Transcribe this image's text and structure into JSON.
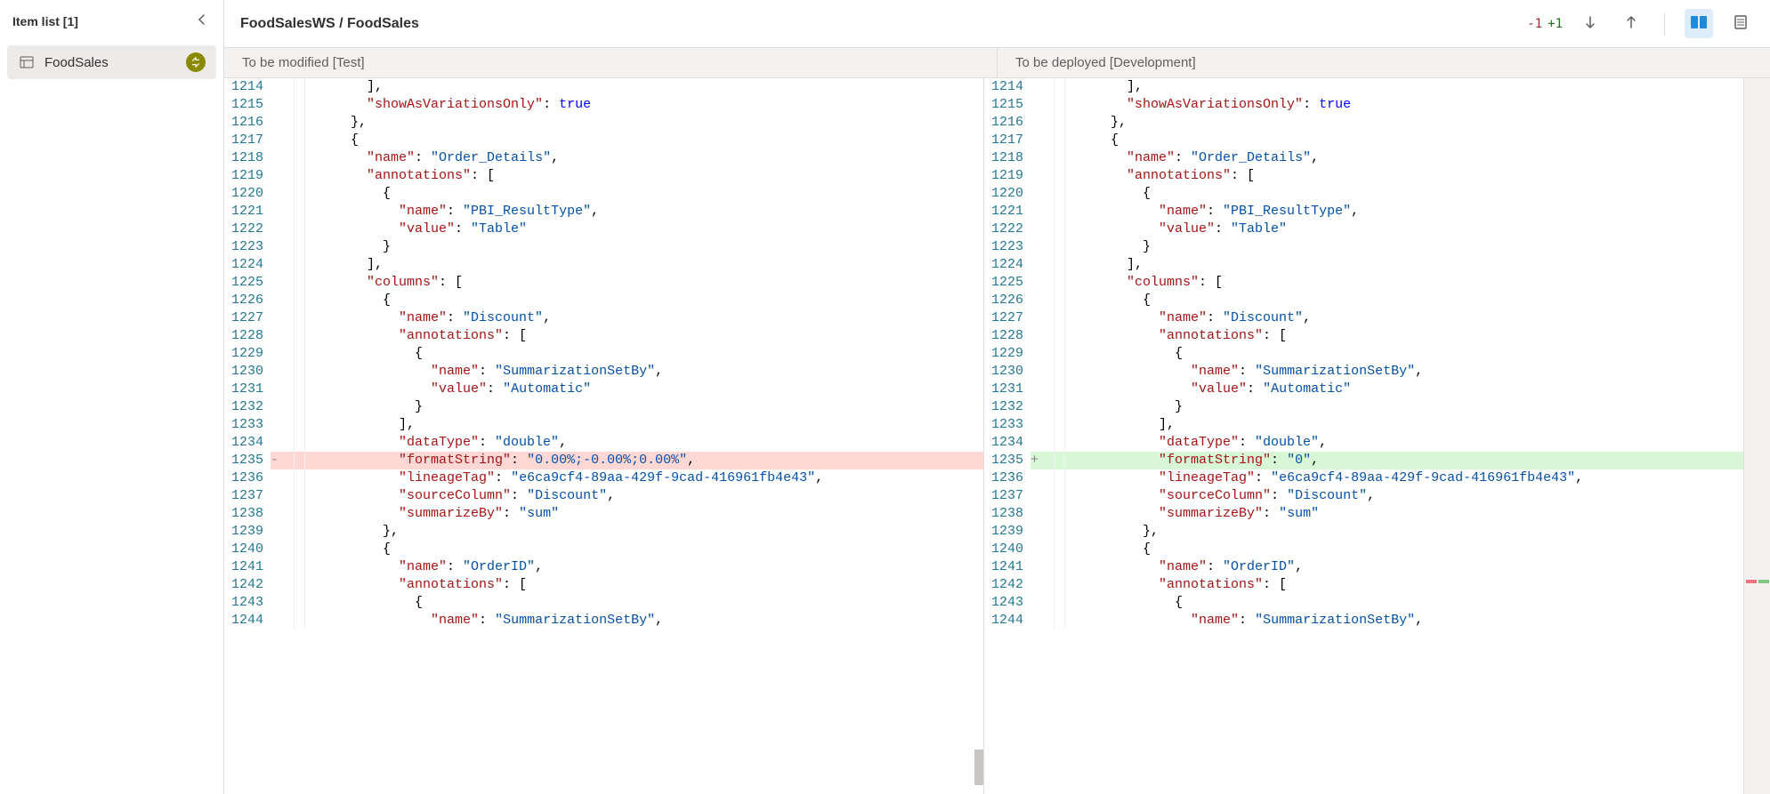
{
  "sidebar": {
    "title": "Item list [1]",
    "items": [
      {
        "label": "FoodSales"
      }
    ]
  },
  "header": {
    "breadcrumb": "FoodSalesWS / FoodSales",
    "deletions": "-1",
    "additions": "+1"
  },
  "panes": {
    "left_title": "To be modified [Test]",
    "right_title": "To be deployed [Development]"
  },
  "code_left": [
    {
      "n": 1214,
      "indent": 3,
      "tokens": [
        [
          "punc",
          "],"
        ]
      ]
    },
    {
      "n": 1215,
      "indent": 3,
      "tokens": [
        [
          "key",
          "\"showAsVariationsOnly\""
        ],
        [
          "punc",
          ": "
        ],
        [
          "bool",
          "true"
        ]
      ]
    },
    {
      "n": 1216,
      "indent": 2,
      "tokens": [
        [
          "punc",
          "},"
        ]
      ]
    },
    {
      "n": 1217,
      "indent": 2,
      "tokens": [
        [
          "punc",
          "{"
        ]
      ]
    },
    {
      "n": 1218,
      "indent": 3,
      "tokens": [
        [
          "key",
          "\"name\""
        ],
        [
          "punc",
          ": "
        ],
        [
          "str",
          "\"Order_Details\""
        ],
        [
          "punc",
          ","
        ]
      ]
    },
    {
      "n": 1219,
      "indent": 3,
      "tokens": [
        [
          "key",
          "\"annotations\""
        ],
        [
          "punc",
          ": ["
        ]
      ]
    },
    {
      "n": 1220,
      "indent": 4,
      "tokens": [
        [
          "punc",
          "{"
        ]
      ]
    },
    {
      "n": 1221,
      "indent": 5,
      "tokens": [
        [
          "key",
          "\"name\""
        ],
        [
          "punc",
          ": "
        ],
        [
          "str",
          "\"PBI_ResultType\""
        ],
        [
          "punc",
          ","
        ]
      ]
    },
    {
      "n": 1222,
      "indent": 5,
      "tokens": [
        [
          "key",
          "\"value\""
        ],
        [
          "punc",
          ": "
        ],
        [
          "str",
          "\"Table\""
        ]
      ]
    },
    {
      "n": 1223,
      "indent": 4,
      "tokens": [
        [
          "punc",
          "}"
        ]
      ]
    },
    {
      "n": 1224,
      "indent": 3,
      "tokens": [
        [
          "punc",
          "],"
        ]
      ]
    },
    {
      "n": 1225,
      "indent": 3,
      "tokens": [
        [
          "key",
          "\"columns\""
        ],
        [
          "punc",
          ": ["
        ]
      ]
    },
    {
      "n": 1226,
      "indent": 4,
      "tokens": [
        [
          "punc",
          "{"
        ]
      ]
    },
    {
      "n": 1227,
      "indent": 5,
      "tokens": [
        [
          "key",
          "\"name\""
        ],
        [
          "punc",
          ": "
        ],
        [
          "str",
          "\"Discount\""
        ],
        [
          "punc",
          ","
        ]
      ]
    },
    {
      "n": 1228,
      "indent": 5,
      "tokens": [
        [
          "key",
          "\"annotations\""
        ],
        [
          "punc",
          ": ["
        ]
      ]
    },
    {
      "n": 1229,
      "indent": 6,
      "tokens": [
        [
          "punc",
          "{"
        ]
      ]
    },
    {
      "n": 1230,
      "indent": 7,
      "tokens": [
        [
          "key",
          "\"name\""
        ],
        [
          "punc",
          ": "
        ],
        [
          "str",
          "\"SummarizationSetBy\""
        ],
        [
          "punc",
          ","
        ]
      ]
    },
    {
      "n": 1231,
      "indent": 7,
      "tokens": [
        [
          "key",
          "\"value\""
        ],
        [
          "punc",
          ": "
        ],
        [
          "str",
          "\"Automatic\""
        ]
      ]
    },
    {
      "n": 1232,
      "indent": 6,
      "tokens": [
        [
          "punc",
          "}"
        ]
      ]
    },
    {
      "n": 1233,
      "indent": 5,
      "tokens": [
        [
          "punc",
          "],"
        ]
      ]
    },
    {
      "n": 1234,
      "indent": 5,
      "tokens": [
        [
          "key",
          "\"dataType\""
        ],
        [
          "punc",
          ": "
        ],
        [
          "str",
          "\"double\""
        ],
        [
          "punc",
          ","
        ]
      ]
    },
    {
      "n": 1235,
      "indent": 5,
      "diff": "removed",
      "tokens": [
        [
          "key",
          "\"formatString\""
        ],
        [
          "punc",
          ": "
        ],
        [
          "str",
          "\"0.00%;-0.00%;0.00%\""
        ],
        [
          "punc",
          ","
        ]
      ]
    },
    {
      "n": 1236,
      "indent": 5,
      "tokens": [
        [
          "key",
          "\"lineageTag\""
        ],
        [
          "punc",
          ": "
        ],
        [
          "str",
          "\"e6ca9cf4-89aa-429f-9cad-416961fb4e43\""
        ],
        [
          "punc",
          ","
        ]
      ]
    },
    {
      "n": 1237,
      "indent": 5,
      "tokens": [
        [
          "key",
          "\"sourceColumn\""
        ],
        [
          "punc",
          ": "
        ],
        [
          "str",
          "\"Discount\""
        ],
        [
          "punc",
          ","
        ]
      ]
    },
    {
      "n": 1238,
      "indent": 5,
      "tokens": [
        [
          "key",
          "\"summarizeBy\""
        ],
        [
          "punc",
          ": "
        ],
        [
          "str",
          "\"sum\""
        ]
      ]
    },
    {
      "n": 1239,
      "indent": 4,
      "tokens": [
        [
          "punc",
          "},"
        ]
      ]
    },
    {
      "n": 1240,
      "indent": 4,
      "tokens": [
        [
          "punc",
          "{"
        ]
      ]
    },
    {
      "n": 1241,
      "indent": 5,
      "tokens": [
        [
          "key",
          "\"name\""
        ],
        [
          "punc",
          ": "
        ],
        [
          "str",
          "\"OrderID\""
        ],
        [
          "punc",
          ","
        ]
      ]
    },
    {
      "n": 1242,
      "indent": 5,
      "tokens": [
        [
          "key",
          "\"annotations\""
        ],
        [
          "punc",
          ": ["
        ]
      ]
    },
    {
      "n": 1243,
      "indent": 6,
      "tokens": [
        [
          "punc",
          "{"
        ]
      ]
    },
    {
      "n": 1244,
      "indent": 7,
      "tokens": [
        [
          "key",
          "\"name\""
        ],
        [
          "punc",
          ": "
        ],
        [
          "str",
          "\"SummarizationSetBy\""
        ],
        [
          "punc",
          ","
        ]
      ]
    }
  ],
  "code_right": [
    {
      "n": 1214,
      "indent": 3,
      "tokens": [
        [
          "punc",
          "],"
        ]
      ]
    },
    {
      "n": 1215,
      "indent": 3,
      "tokens": [
        [
          "key",
          "\"showAsVariationsOnly\""
        ],
        [
          "punc",
          ": "
        ],
        [
          "bool",
          "true"
        ]
      ]
    },
    {
      "n": 1216,
      "indent": 2,
      "tokens": [
        [
          "punc",
          "},"
        ]
      ]
    },
    {
      "n": 1217,
      "indent": 2,
      "tokens": [
        [
          "punc",
          "{"
        ]
      ]
    },
    {
      "n": 1218,
      "indent": 3,
      "tokens": [
        [
          "key",
          "\"name\""
        ],
        [
          "punc",
          ": "
        ],
        [
          "str",
          "\"Order_Details\""
        ],
        [
          "punc",
          ","
        ]
      ]
    },
    {
      "n": 1219,
      "indent": 3,
      "tokens": [
        [
          "key",
          "\"annotations\""
        ],
        [
          "punc",
          ": ["
        ]
      ]
    },
    {
      "n": 1220,
      "indent": 4,
      "tokens": [
        [
          "punc",
          "{"
        ]
      ]
    },
    {
      "n": 1221,
      "indent": 5,
      "tokens": [
        [
          "key",
          "\"name\""
        ],
        [
          "punc",
          ": "
        ],
        [
          "str",
          "\"PBI_ResultType\""
        ],
        [
          "punc",
          ","
        ]
      ]
    },
    {
      "n": 1222,
      "indent": 5,
      "tokens": [
        [
          "key",
          "\"value\""
        ],
        [
          "punc",
          ": "
        ],
        [
          "str",
          "\"Table\""
        ]
      ]
    },
    {
      "n": 1223,
      "indent": 4,
      "tokens": [
        [
          "punc",
          "}"
        ]
      ]
    },
    {
      "n": 1224,
      "indent": 3,
      "tokens": [
        [
          "punc",
          "],"
        ]
      ]
    },
    {
      "n": 1225,
      "indent": 3,
      "tokens": [
        [
          "key",
          "\"columns\""
        ],
        [
          "punc",
          ": ["
        ]
      ]
    },
    {
      "n": 1226,
      "indent": 4,
      "tokens": [
        [
          "punc",
          "{"
        ]
      ]
    },
    {
      "n": 1227,
      "indent": 5,
      "tokens": [
        [
          "key",
          "\"name\""
        ],
        [
          "punc",
          ": "
        ],
        [
          "str",
          "\"Discount\""
        ],
        [
          "punc",
          ","
        ]
      ]
    },
    {
      "n": 1228,
      "indent": 5,
      "tokens": [
        [
          "key",
          "\"annotations\""
        ],
        [
          "punc",
          ": ["
        ]
      ]
    },
    {
      "n": 1229,
      "indent": 6,
      "tokens": [
        [
          "punc",
          "{"
        ]
      ]
    },
    {
      "n": 1230,
      "indent": 7,
      "tokens": [
        [
          "key",
          "\"name\""
        ],
        [
          "punc",
          ": "
        ],
        [
          "str",
          "\"SummarizationSetBy\""
        ],
        [
          "punc",
          ","
        ]
      ]
    },
    {
      "n": 1231,
      "indent": 7,
      "tokens": [
        [
          "key",
          "\"value\""
        ],
        [
          "punc",
          ": "
        ],
        [
          "str",
          "\"Automatic\""
        ]
      ]
    },
    {
      "n": 1232,
      "indent": 6,
      "tokens": [
        [
          "punc",
          "}"
        ]
      ]
    },
    {
      "n": 1233,
      "indent": 5,
      "tokens": [
        [
          "punc",
          "],"
        ]
      ]
    },
    {
      "n": 1234,
      "indent": 5,
      "tokens": [
        [
          "key",
          "\"dataType\""
        ],
        [
          "punc",
          ": "
        ],
        [
          "str",
          "\"double\""
        ],
        [
          "punc",
          ","
        ]
      ]
    },
    {
      "n": 1235,
      "indent": 5,
      "diff": "added",
      "tokens": [
        [
          "key",
          "\"formatString\""
        ],
        [
          "punc",
          ": "
        ],
        [
          "str",
          "\"0\""
        ],
        [
          "punc",
          ","
        ]
      ]
    },
    {
      "n": 1236,
      "indent": 5,
      "tokens": [
        [
          "key",
          "\"lineageTag\""
        ],
        [
          "punc",
          ": "
        ],
        [
          "str",
          "\"e6ca9cf4-89aa-429f-9cad-416961fb4e43\""
        ],
        [
          "punc",
          ","
        ]
      ]
    },
    {
      "n": 1237,
      "indent": 5,
      "tokens": [
        [
          "key",
          "\"sourceColumn\""
        ],
        [
          "punc",
          ": "
        ],
        [
          "str",
          "\"Discount\""
        ],
        [
          "punc",
          ","
        ]
      ]
    },
    {
      "n": 1238,
      "indent": 5,
      "tokens": [
        [
          "key",
          "\"summarizeBy\""
        ],
        [
          "punc",
          ": "
        ],
        [
          "str",
          "\"sum\""
        ]
      ]
    },
    {
      "n": 1239,
      "indent": 4,
      "tokens": [
        [
          "punc",
          "},"
        ]
      ]
    },
    {
      "n": 1240,
      "indent": 4,
      "tokens": [
        [
          "punc",
          "{"
        ]
      ]
    },
    {
      "n": 1241,
      "indent": 5,
      "tokens": [
        [
          "key",
          "\"name\""
        ],
        [
          "punc",
          ": "
        ],
        [
          "str",
          "\"OrderID\""
        ],
        [
          "punc",
          ","
        ]
      ]
    },
    {
      "n": 1242,
      "indent": 5,
      "tokens": [
        [
          "key",
          "\"annotations\""
        ],
        [
          "punc",
          ": ["
        ]
      ]
    },
    {
      "n": 1243,
      "indent": 6,
      "tokens": [
        [
          "punc",
          "{"
        ]
      ]
    },
    {
      "n": 1244,
      "indent": 7,
      "tokens": [
        [
          "key",
          "\"name\""
        ],
        [
          "punc",
          ": "
        ],
        [
          "str",
          "\"SummarizationSetBy\""
        ],
        [
          "punc",
          ","
        ]
      ]
    }
  ]
}
